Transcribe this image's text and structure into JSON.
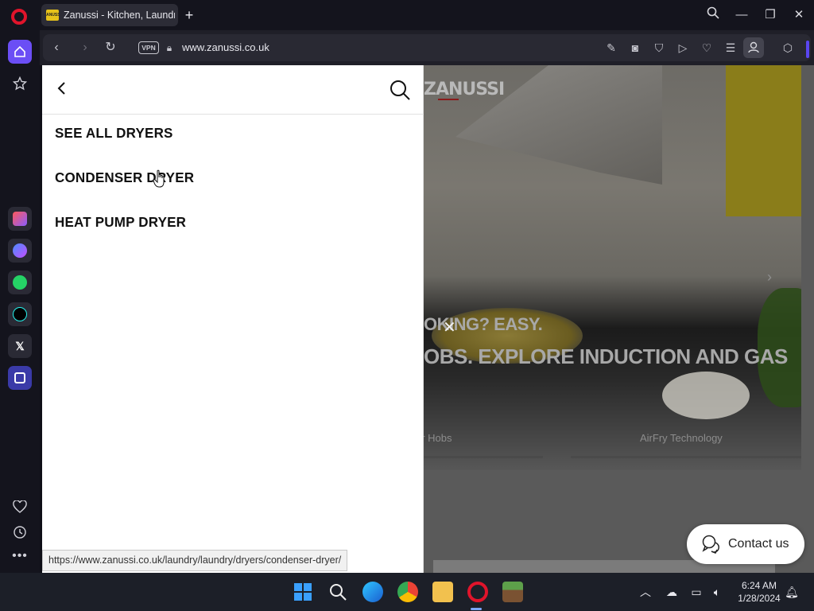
{
  "browser": {
    "tab_title": "Zanussi - Kitchen, Laundry",
    "tab_favicon_text": "ZANUSSI",
    "url": "www.zanussi.co.uk",
    "vpn_label": "VPN"
  },
  "menu": {
    "items": [
      {
        "label": "SEE ALL DRYERS"
      },
      {
        "label": "CONDENSER DRYER"
      },
      {
        "label": "HEAT PUMP DRYER"
      }
    ]
  },
  "hero": {
    "brand": "ZANUSSI",
    "line1": "OKING? EASY.",
    "line2": "OBS. EXPLORE INDUCTION AND GAS",
    "caption_left": "er Hobs",
    "caption_right": "AirFry Technology"
  },
  "status_url": "https://www.zanussi.co.uk/laundry/laundry/dryers/condenser-dryer/",
  "contact": {
    "label": "Contact us"
  },
  "clock": {
    "time": "6:24 AM",
    "date": "1/28/2024"
  },
  "colors": {
    "accent": "#6b4ef5",
    "opera_red": "#e0142b",
    "brand_yellow": "#e6c11a"
  }
}
